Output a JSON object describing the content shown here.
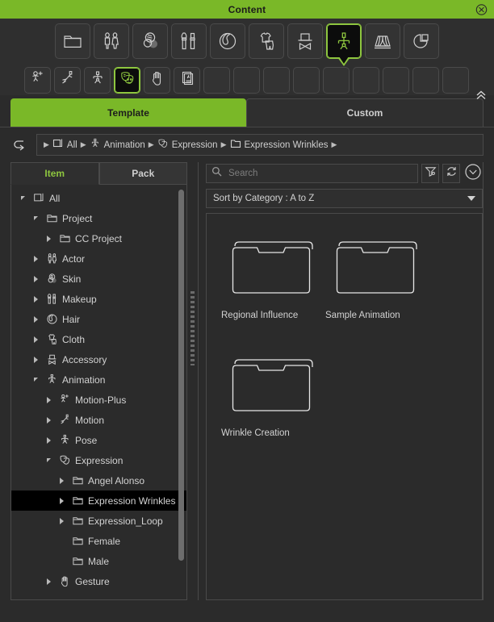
{
  "window": {
    "title": "Content",
    "close_icon": "close-circle-icon",
    "accent": "#7ab828",
    "background": "#2b2b2b"
  },
  "toolbar_primary": {
    "items": [
      {
        "name": "project",
        "icon": "folder-icon",
        "selected": false
      },
      {
        "name": "actor",
        "icon": "two-figures-icon",
        "selected": false
      },
      {
        "name": "skin",
        "icon": "skin-spheres-icon",
        "selected": false
      },
      {
        "name": "makeup",
        "icon": "brush-lipstick-icon",
        "selected": false
      },
      {
        "name": "hair",
        "icon": "hair-icon",
        "selected": false
      },
      {
        "name": "cloth",
        "icon": "shirt-pants-icon",
        "selected": false
      },
      {
        "name": "accessory",
        "icon": "hat-bowtie-icon",
        "selected": false
      },
      {
        "name": "animation",
        "icon": "stick-figure-icon",
        "selected": true
      },
      {
        "name": "stage",
        "icon": "stage-curtain-icon",
        "selected": false
      },
      {
        "name": "misc",
        "icon": "pie-square-icon",
        "selected": false
      }
    ]
  },
  "toolbar_secondary": {
    "items": [
      {
        "name": "motion-plus",
        "icon": "motion-plus-icon",
        "selected": false,
        "empty": false
      },
      {
        "name": "motion",
        "icon": "running-figure-icon",
        "selected": false,
        "empty": false
      },
      {
        "name": "pose",
        "icon": "pose-figure-icon",
        "selected": false,
        "empty": false
      },
      {
        "name": "expression",
        "icon": "theater-masks-icon",
        "selected": true,
        "empty": false
      },
      {
        "name": "gesture",
        "icon": "hand-icon",
        "selected": false,
        "empty": false
      },
      {
        "name": "script",
        "icon": "document-figure-icon",
        "selected": false,
        "empty": false
      },
      {
        "name": "slot-7",
        "icon": "",
        "selected": false,
        "empty": true
      },
      {
        "name": "slot-8",
        "icon": "",
        "selected": false,
        "empty": true
      },
      {
        "name": "slot-9",
        "icon": "",
        "selected": false,
        "empty": true
      },
      {
        "name": "slot-10",
        "icon": "",
        "selected": false,
        "empty": true
      },
      {
        "name": "slot-11",
        "icon": "",
        "selected": false,
        "empty": true
      },
      {
        "name": "slot-12",
        "icon": "",
        "selected": false,
        "empty": true
      },
      {
        "name": "slot-13",
        "icon": "",
        "selected": false,
        "empty": true
      },
      {
        "name": "slot-14",
        "icon": "",
        "selected": false,
        "empty": true
      },
      {
        "name": "slot-15",
        "icon": "",
        "selected": false,
        "empty": true
      }
    ],
    "collapse_icon": "double-chevron-up-icon"
  },
  "main_tabs": [
    {
      "label": "Template",
      "active": true
    },
    {
      "label": "Custom",
      "active": false
    }
  ],
  "breadcrumb": {
    "back_icon": "back-arrow-icon",
    "items": [
      {
        "label": "All",
        "icon": "all-square-icon"
      },
      {
        "label": "Animation",
        "icon": "pose-figure-icon"
      },
      {
        "label": "Expression",
        "icon": "theater-masks-icon"
      },
      {
        "label": "Expression Wrinkles",
        "icon": "folder-icon"
      }
    ]
  },
  "left_panel": {
    "tabs": [
      {
        "label": "Item",
        "active": true
      },
      {
        "label": "Pack",
        "active": false
      }
    ],
    "tree": [
      {
        "label": "All",
        "depth": 0,
        "icon": "all-square-icon",
        "state": "expanded",
        "selected": false
      },
      {
        "label": "Project",
        "depth": 1,
        "icon": "folder-icon",
        "state": "expanded",
        "selected": false
      },
      {
        "label": "CC Project",
        "depth": 2,
        "icon": "folder-icon",
        "state": "collapsed",
        "selected": false
      },
      {
        "label": "Actor",
        "depth": 1,
        "icon": "two-figures-icon",
        "state": "collapsed",
        "selected": false
      },
      {
        "label": "Skin",
        "depth": 1,
        "icon": "skin-spheres-icon",
        "state": "collapsed",
        "selected": false
      },
      {
        "label": "Makeup",
        "depth": 1,
        "icon": "brush-lipstick-icon",
        "state": "collapsed",
        "selected": false
      },
      {
        "label": "Hair",
        "depth": 1,
        "icon": "hair-icon",
        "state": "collapsed",
        "selected": false
      },
      {
        "label": "Cloth",
        "depth": 1,
        "icon": "shirt-pants-icon",
        "state": "collapsed",
        "selected": false
      },
      {
        "label": "Accessory",
        "depth": 1,
        "icon": "hat-bowtie-icon",
        "state": "collapsed",
        "selected": false
      },
      {
        "label": "Animation",
        "depth": 1,
        "icon": "pose-figure-icon",
        "state": "expanded",
        "selected": false
      },
      {
        "label": "Motion-Plus",
        "depth": 2,
        "icon": "motion-plus-icon",
        "state": "collapsed",
        "selected": false
      },
      {
        "label": "Motion",
        "depth": 2,
        "icon": "running-figure-icon",
        "state": "collapsed",
        "selected": false
      },
      {
        "label": "Pose",
        "depth": 2,
        "icon": "pose-figure-icon",
        "state": "collapsed",
        "selected": false
      },
      {
        "label": "Expression",
        "depth": 2,
        "icon": "theater-masks-icon",
        "state": "expanded",
        "selected": false
      },
      {
        "label": "Angel Alonso",
        "depth": 3,
        "icon": "folder-icon",
        "state": "collapsed",
        "selected": false
      },
      {
        "label": "Expression Wrinkles",
        "depth": 3,
        "icon": "folder-icon",
        "state": "collapsed",
        "selected": true
      },
      {
        "label": "Expression_Loop",
        "depth": 3,
        "icon": "folder-icon",
        "state": "collapsed",
        "selected": false
      },
      {
        "label": "Female",
        "depth": 3,
        "icon": "folder-icon",
        "state": "leaf",
        "selected": false
      },
      {
        "label": "Male",
        "depth": 3,
        "icon": "folder-icon",
        "state": "leaf",
        "selected": false
      },
      {
        "label": "Gesture",
        "depth": 2,
        "icon": "hand-icon",
        "state": "collapsed",
        "selected": false
      }
    ]
  },
  "right_panel": {
    "search": {
      "value": "",
      "placeholder": "Search",
      "search_icon": "search-icon"
    },
    "buttons": [
      {
        "name": "filter-settings-button",
        "icon": "filter-gear-icon"
      },
      {
        "name": "refresh-button",
        "icon": "refresh-icon"
      },
      {
        "name": "more-options-button",
        "icon": "chevron-down-circle-icon"
      }
    ],
    "sort": {
      "label": "Sort by Category : A to Z",
      "caret_icon": "caret-down-icon"
    },
    "items": [
      {
        "label": "Regional Influence",
        "icon": "folder-thumb-icon"
      },
      {
        "label": "Sample Animation",
        "icon": "folder-thumb-icon"
      },
      {
        "label": "Wrinkle Creation",
        "icon": "folder-thumb-icon"
      }
    ]
  }
}
